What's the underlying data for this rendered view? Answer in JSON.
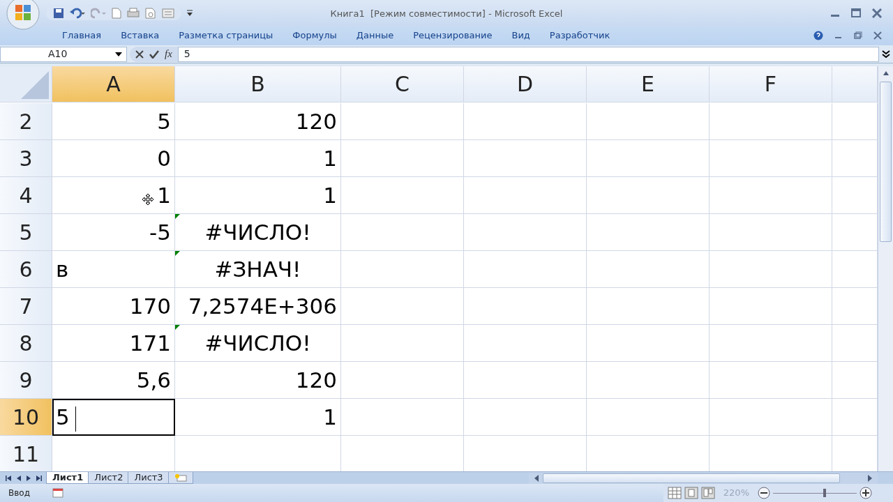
{
  "window": {
    "title": "Книга1  [Режим совместимости] - Microsoft Excel"
  },
  "ribbon_tabs": [
    {
      "label": "Главная"
    },
    {
      "label": "Вставка"
    },
    {
      "label": "Разметка страницы"
    },
    {
      "label": "Формулы"
    },
    {
      "label": "Данные"
    },
    {
      "label": "Рецензирование"
    },
    {
      "label": "Вид"
    },
    {
      "label": "Разработчик"
    }
  ],
  "formula_bar": {
    "name_box": "A10",
    "fx": "fx",
    "value": "5"
  },
  "columns": [
    {
      "label": "A",
      "selected": true
    },
    {
      "label": "B",
      "selected": false
    },
    {
      "label": "C",
      "selected": false
    },
    {
      "label": "D",
      "selected": false
    },
    {
      "label": "E",
      "selected": false
    },
    {
      "label": "F",
      "selected": false
    }
  ],
  "rows": [
    {
      "header": "2",
      "selected": false,
      "cells": [
        {
          "text": "5",
          "kind": "number",
          "flag": false
        },
        {
          "text": "120",
          "kind": "number",
          "flag": false
        }
      ]
    },
    {
      "header": "3",
      "selected": false,
      "cells": [
        {
          "text": "0",
          "kind": "number",
          "flag": false
        },
        {
          "text": "1",
          "kind": "number",
          "flag": false
        }
      ]
    },
    {
      "header": "4",
      "selected": false,
      "cells": [
        {
          "text": "1",
          "kind": "number",
          "flag": false,
          "pointer": true
        },
        {
          "text": "1",
          "kind": "number",
          "flag": false
        }
      ]
    },
    {
      "header": "5",
      "selected": false,
      "cells": [
        {
          "text": "-5",
          "kind": "number",
          "flag": false
        },
        {
          "text": "#ЧИСЛО!",
          "kind": "error",
          "flag": true
        }
      ]
    },
    {
      "header": "6",
      "selected": false,
      "cells": [
        {
          "text": "в",
          "kind": "text",
          "flag": false
        },
        {
          "text": "#ЗНАЧ!",
          "kind": "error",
          "flag": true
        }
      ]
    },
    {
      "header": "7",
      "selected": false,
      "cells": [
        {
          "text": "170",
          "kind": "number",
          "flag": false
        },
        {
          "text": "7,2574E+306",
          "kind": "number",
          "flag": false
        }
      ]
    },
    {
      "header": "8",
      "selected": false,
      "cells": [
        {
          "text": "171",
          "kind": "number",
          "flag": false
        },
        {
          "text": "#ЧИСЛО!",
          "kind": "error",
          "flag": true
        }
      ]
    },
    {
      "header": "9",
      "selected": false,
      "cells": [
        {
          "text": "5,6",
          "kind": "number",
          "flag": false
        },
        {
          "text": "120",
          "kind": "number",
          "flag": false
        }
      ]
    },
    {
      "header": "10",
      "selected": true,
      "cells": [
        {
          "text": "5",
          "kind": "edit",
          "flag": false
        },
        {
          "text": "1",
          "kind": "number",
          "flag": false
        }
      ]
    },
    {
      "header": "11",
      "selected": false,
      "cells": []
    }
  ],
  "sheet_tabs": [
    {
      "label": "Лист1",
      "selected": true
    },
    {
      "label": "Лист2",
      "selected": false
    },
    {
      "label": "Лист3",
      "selected": false
    }
  ],
  "status_bar": {
    "mode": "Ввод",
    "zoom": "220%",
    "zoom_slider": {
      "level": 0.62
    }
  }
}
